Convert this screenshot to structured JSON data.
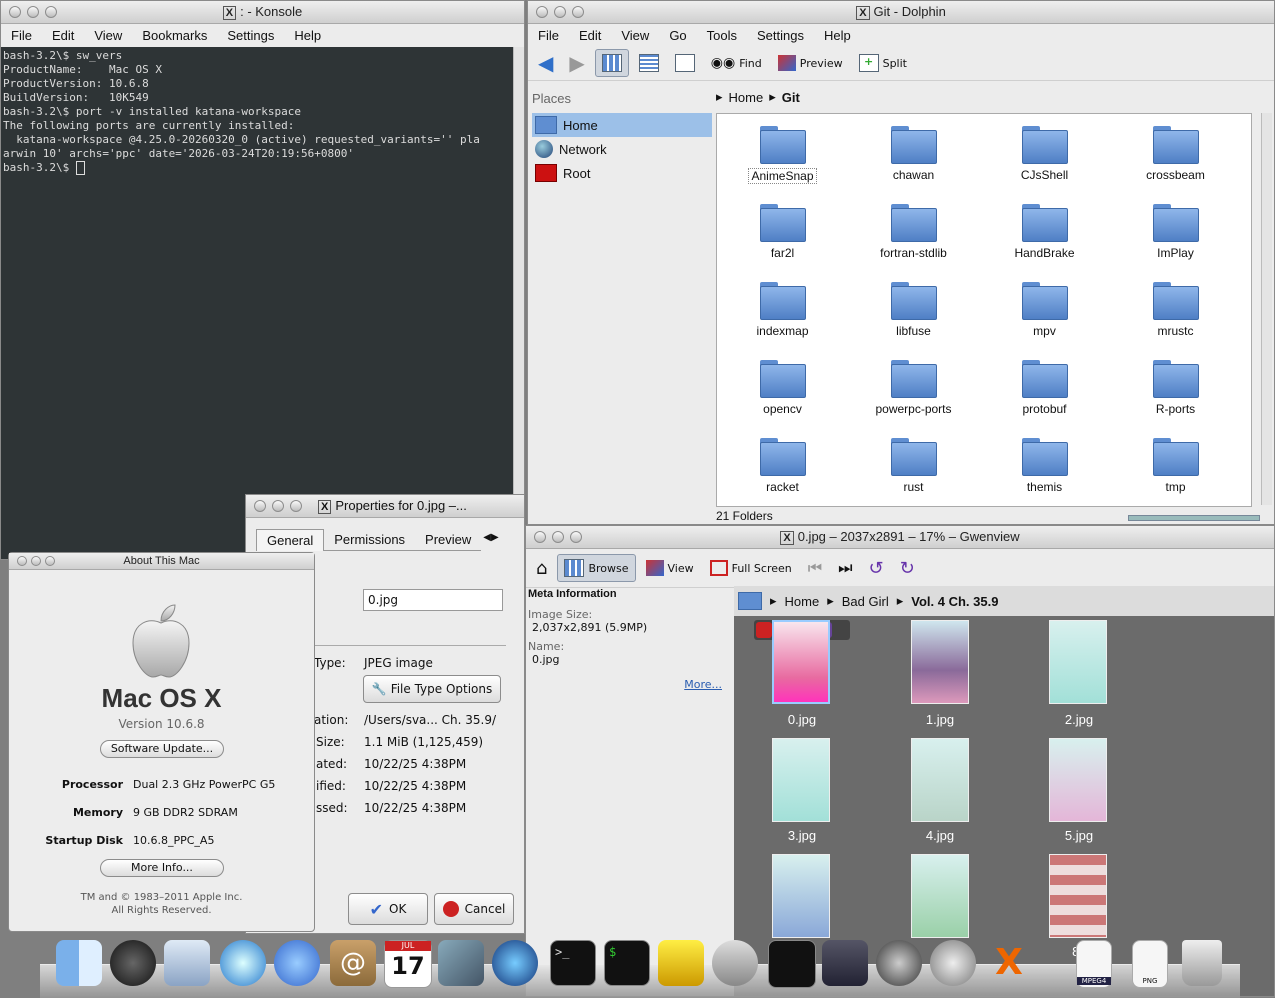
{
  "konsole": {
    "title": ": - Konsole",
    "menu": [
      "File",
      "Edit",
      "View",
      "Bookmarks",
      "Settings",
      "Help"
    ],
    "lines": [
      "bash-3.2\\$ sw_vers",
      "ProductName:    Mac OS X",
      "ProductVersion: 10.6.8",
      "BuildVersion:   10K549",
      "bash-3.2\\$ port -v installed katana-workspace",
      "The following ports are currently installed:",
      "  katana-workspace @4.25.0-20260320_0 (active) requested_variants='' pla",
      "arwin 10' archs='ppc' date='2026-03-24T20:19:56+0800'",
      "bash-3.2\\$ "
    ]
  },
  "dolphin": {
    "title": "Git - Dolphin",
    "menu": [
      "File",
      "Edit",
      "View",
      "Go",
      "Tools",
      "Settings",
      "Help"
    ],
    "toolbar": {
      "find": "Find",
      "preview": "Preview",
      "split": "Split"
    },
    "places_header": "Places",
    "places": [
      "Home",
      "Network",
      "Root"
    ],
    "breadcrumb": [
      "Home",
      "Git"
    ],
    "folders": [
      "AnimeSnap",
      "chawan",
      "CJsShell",
      "crossbeam",
      "far2l",
      "fortran-stdlib",
      "HandBrake",
      "ImPlay",
      "indexmap",
      "libfuse",
      "mpv",
      "mrustc",
      "opencv",
      "powerpc-ports",
      "protobuf",
      "R-ports",
      "racket",
      "rust",
      "themis",
      "tmp"
    ],
    "status": "21 Folders"
  },
  "gwenview": {
    "title": "0.jpg – 2037x2891 – 17% – Gwenview",
    "toolbar": {
      "browse": "Browse",
      "view": "View",
      "fullscreen": "Full Screen"
    },
    "meta_header": "Meta Information",
    "image_size_label": "Image Size:",
    "image_size_value": "2,037x2,891 (5.9MP)",
    "name_label": "Name:",
    "name_value": "0.jpg",
    "more": "More...",
    "breadcrumb": [
      "Home",
      "Bad Girl",
      "Vol. 4 Ch. 35.9"
    ],
    "thumbs": [
      "0.jpg",
      "1.jpg",
      "2.jpg",
      "3.jpg",
      "4.jpg",
      "5.jpg",
      "",
      "",
      "8.j"
    ]
  },
  "properties": {
    "title": "Properties for 0.jpg –...",
    "tabs": [
      "General",
      "Permissions",
      "Preview"
    ],
    "filename": "0.jpg",
    "type_label": "Type:",
    "type_value": "JPEG image",
    "file_type_options": "File Type Options",
    "location_label": "ation:",
    "location_value": "/Users/sva... Ch. 35.9/",
    "size_label": "Size:",
    "size_value": "1.1 MiB (1,125,459)",
    "created_label": "ated:",
    "created_value": "10/22/25 4:38PM",
    "modified_label": "ified:",
    "modified_value": "10/22/25 4:38PM",
    "accessed_label": "ssed:",
    "accessed_value": "10/22/25 4:38PM",
    "ok": "OK",
    "cancel": "Cancel"
  },
  "about": {
    "title": "About This Mac",
    "os": "Mac OS X",
    "version": "Version 10.6.8",
    "software_update": "Software Update...",
    "processor_label": "Processor",
    "processor_value": "Dual 2.3 GHz PowerPC G5",
    "memory_label": "Memory",
    "memory_value": "9 GB DDR2 SDRAM",
    "disk_label": "Startup Disk",
    "disk_value": "10.6.8_PPC_A5",
    "more_info": "More Info...",
    "copyright1": "TM and © 1983–2011 Apple Inc.",
    "copyright2": "All Rights Reserved."
  },
  "dock": {
    "calendar_day": "17",
    "calendar_month": "JUL",
    "mpeg_label": "MPEG4",
    "png_label": "PNG"
  }
}
